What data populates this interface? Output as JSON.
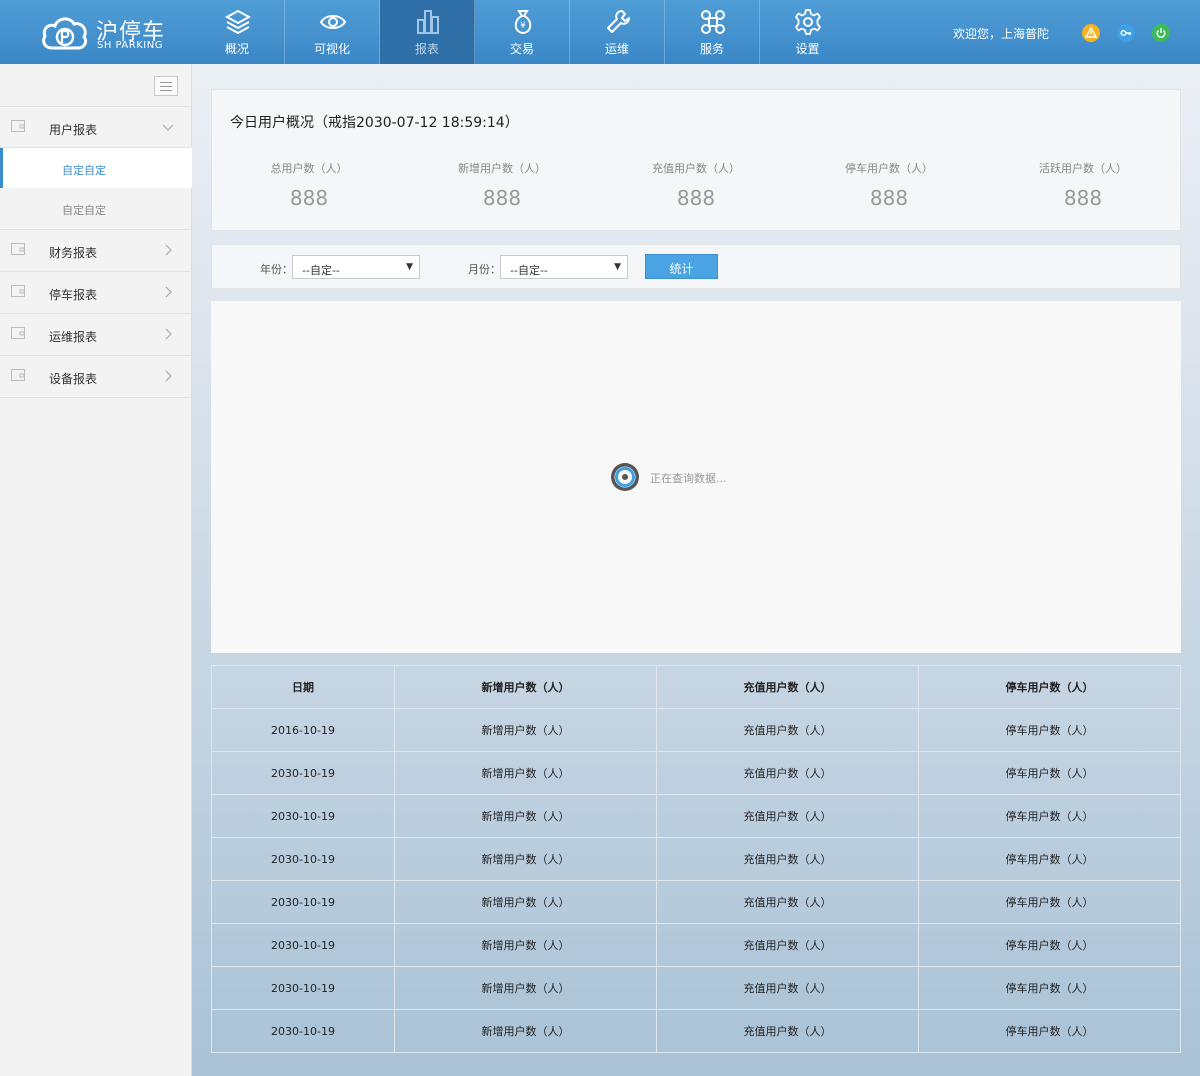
{
  "brand": {
    "name": "沪停车",
    "subtitle": "SH PARKING",
    "primary_color": "#3b87c7",
    "active_nav_color": "#2f6fa8",
    "accent_color": "#4aa3e2"
  },
  "nav": {
    "items": [
      {
        "label": "概况",
        "icon": "layers-icon"
      },
      {
        "label": "可视化",
        "icon": "eye-icon"
      },
      {
        "label": "报表",
        "icon": "bar-chart-icon",
        "active": true
      },
      {
        "label": "交易",
        "icon": "money-bag-icon"
      },
      {
        "label": "运维",
        "icon": "wrench-icon"
      },
      {
        "label": "服务",
        "icon": "command-icon"
      },
      {
        "label": "设置",
        "icon": "gear-icon"
      }
    ]
  },
  "user": {
    "welcome": "欢迎您，上海普陀",
    "icons": [
      {
        "name": "notification-icon",
        "color": "#f5b323"
      },
      {
        "name": "key-icon",
        "color": "#3fa0e6"
      },
      {
        "name": "power-icon",
        "color": "#3dbb55"
      }
    ]
  },
  "sidebar": {
    "groups": [
      {
        "label": "用户报表",
        "expanded": true,
        "children": [
          {
            "label": "自定自定",
            "active": true
          },
          {
            "label": "自定自定",
            "active": false
          }
        ]
      },
      {
        "label": "财务报表"
      },
      {
        "label": "停车报表"
      },
      {
        "label": "运维报表"
      },
      {
        "label": "设备报表"
      }
    ]
  },
  "overview": {
    "title": "今日用户概况（戒指2030-07-12 18:59:14）",
    "stats": [
      {
        "label": "总用户数（人）",
        "value": "888"
      },
      {
        "label": "新增用户数（人）",
        "value": "888"
      },
      {
        "label": "充值用户数（人）",
        "value": "888"
      },
      {
        "label": "停车用户数（人）",
        "value": "888"
      },
      {
        "label": "活跃用户数（人）",
        "value": "888"
      }
    ]
  },
  "filter": {
    "year_label": "年份：",
    "year_value": "--自定--",
    "month_label": "月份：",
    "month_value": "--自定--",
    "submit_label": "统计"
  },
  "chart_area": {
    "loading_text": "正在查询数据..."
  },
  "table": {
    "headers": [
      "日期",
      "新增用户数（人）",
      "充值用户数（人）",
      "停车用户数（人）"
    ],
    "rows": [
      [
        "2016-10-19",
        "新增用户数（人）",
        "充值用户数（人）",
        "停车用户数（人）"
      ],
      [
        "2030-10-19",
        "新增用户数（人）",
        "充值用户数（人）",
        "停车用户数（人）"
      ],
      [
        "2030-10-19",
        "新增用户数（人）",
        "充值用户数（人）",
        "停车用户数（人）"
      ],
      [
        "2030-10-19",
        "新增用户数（人）",
        "充值用户数（人）",
        "停车用户数（人）"
      ],
      [
        "2030-10-19",
        "新增用户数（人）",
        "充值用户数（人）",
        "停车用户数（人）"
      ],
      [
        "2030-10-19",
        "新增用户数（人）",
        "充值用户数（人）",
        "停车用户数（人）"
      ],
      [
        "2030-10-19",
        "新增用户数（人）",
        "充值用户数（人）",
        "停车用户数（人）"
      ],
      [
        "2030-10-19",
        "新增用户数（人）",
        "充值用户数（人）",
        "停车用户数（人）"
      ]
    ]
  }
}
